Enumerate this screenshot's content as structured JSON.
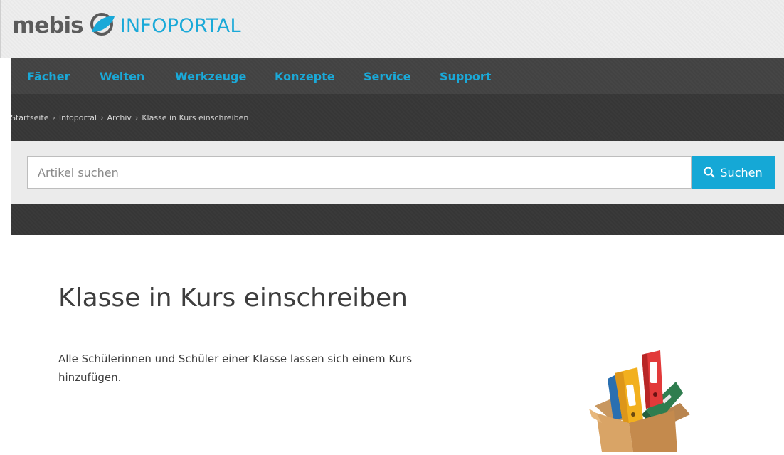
{
  "logo": {
    "mebis": "mebis",
    "portal": "INFOPORTAL"
  },
  "nav": {
    "items": [
      {
        "label": "Fächer"
      },
      {
        "label": "Welten"
      },
      {
        "label": "Werkzeuge"
      },
      {
        "label": "Konzepte"
      },
      {
        "label": "Service"
      },
      {
        "label": "Support"
      }
    ]
  },
  "breadcrumb": {
    "items": [
      "Startseite",
      "Infoportal",
      "Archiv",
      "Klasse in Kurs einschreiben"
    ],
    "separator": "›"
  },
  "search": {
    "placeholder": "Artikel suchen",
    "value": "",
    "button_label": "Suchen"
  },
  "article": {
    "title": "Klasse in Kurs einschreiben",
    "intro": "Alle Schülerinnen und Schüler einer Klasse lassen sich einem Kurs hinzufügen."
  },
  "colors": {
    "accent": "#1aa9d8",
    "nav_bg": "#424242",
    "dark_bg": "#363636",
    "search_bg": "#ebebeb"
  },
  "icons": {
    "logo_mark": "leaf-logo-icon",
    "search": "search-icon",
    "illustration": "folders-in-box-icon"
  }
}
